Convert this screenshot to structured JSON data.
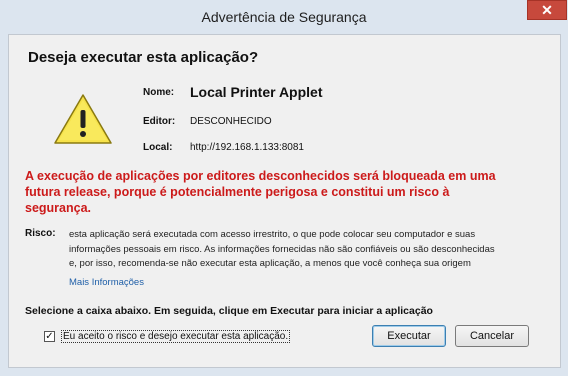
{
  "window": {
    "title": "Advertência de Segurança",
    "close_glyph": "✕"
  },
  "dialog": {
    "heading": "Deseja executar esta aplicação?",
    "icon": "warning-triangle-icon",
    "fields": {
      "name_label": "Nome:",
      "name_value": "Local Printer Applet",
      "publisher_label": "Editor:",
      "publisher_value": "DESCONHECIDO",
      "location_label": "Local:",
      "location_value": "http://192.168.1.133:8081"
    },
    "warning_line1": "A execução de aplicações por editores desconhecidos será bloqueada em uma",
    "warning_line2": "futura release, porque é potencialmente perigosa e constitui um risco à",
    "warning_line3": "segurança.",
    "risk_label": "Risco:",
    "risk_line1": "esta aplicação será executada com acesso irrestrito, o que pode colocar seu computador e suas",
    "risk_line2": "informações pessoais em risco. As informações fornecidas não são confiáveis ou são desconhecidas",
    "risk_line3": "e, por isso, recomenda-se não executar esta aplicação, a menos que você conheça sua origem",
    "more_info": "Mais Informações",
    "instruction": "Selecione a caixa abaixo. Em seguida, clique em Executar para iniciar a aplicação",
    "checkbox_label": "Eu aceito o risco e desejo executar esta aplicação.",
    "checkbox_checked": true,
    "checkbox_glyph": "✓",
    "execute_label": "Executar",
    "cancel_label": "Cancelar"
  },
  "colors": {
    "warning_text": "#cc1a1a",
    "link": "#1f5fa8",
    "close_button": "#c7493c"
  }
}
